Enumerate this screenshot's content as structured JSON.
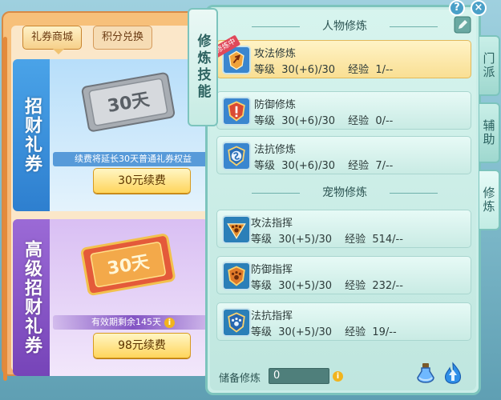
{
  "shop": {
    "tabs": [
      {
        "label": "礼券商城",
        "active": true
      },
      {
        "label": "积分兑换",
        "active": false
      }
    ],
    "offers": [
      {
        "title": "招财礼券",
        "ticket_text": "30天",
        "note": "续费将延长30天普通礼券权益",
        "button": "30元续费"
      },
      {
        "title": "高级招财礼券",
        "ticket_text": "30天",
        "note": "有效期剩余145天",
        "button": "98元续费"
      }
    ]
  },
  "panel": {
    "main_tab": "修炼技能",
    "side_tabs": [
      {
        "label": "门派",
        "active": false
      },
      {
        "label": "辅助",
        "active": false
      },
      {
        "label": "修炼",
        "active": true
      }
    ],
    "character_section": "人物修炼",
    "pet_section": "宠物修炼",
    "level_label": "等级",
    "exp_label": "经验",
    "character_skills": [
      {
        "name": "攻法修炼",
        "level": "30(+6)/30",
        "exp": "1/--",
        "selected": true,
        "badge": "修炼中"
      },
      {
        "name": "防御修炼",
        "level": "30(+6)/30",
        "exp": "0/--",
        "selected": false
      },
      {
        "name": "法抗修炼",
        "level": "30(+6)/30",
        "exp": "7/--",
        "selected": false
      }
    ],
    "pet_skills": [
      {
        "name": "攻法指挥",
        "level": "30(+5)/30",
        "exp": "514/--"
      },
      {
        "name": "防御指挥",
        "level": "30(+5)/30",
        "exp": "232/--"
      },
      {
        "name": "法抗指挥",
        "level": "30(+5)/30",
        "exp": "19/--"
      }
    ],
    "reserve_label": "储备修炼",
    "reserve_value": "0",
    "help_symbol": "?",
    "close_symbol": "×",
    "info_symbol": "i"
  },
  "colors": {
    "panel_bg": "#cbeee8",
    "selected_row": "#f9df93",
    "buy_button": "#ffd55c",
    "offer_blue": "#2e7fcf",
    "offer_purple": "#7644b8"
  }
}
